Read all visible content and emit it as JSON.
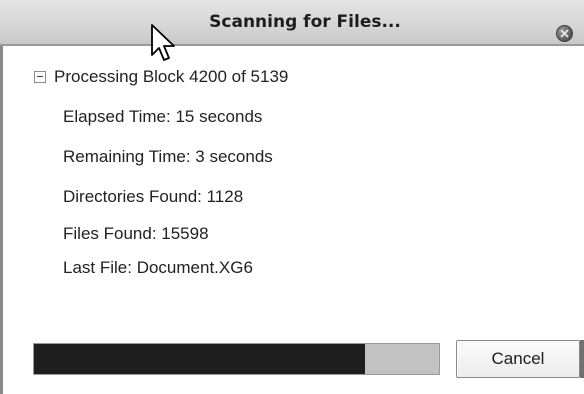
{
  "window": {
    "title": "Scanning for Files..."
  },
  "scan": {
    "heading": "Processing Block 4200 of 5139",
    "details": [
      "Elapsed Time: 15 seconds",
      "Remaining Time: 3 seconds",
      "Directories Found: 1128",
      "Files Found: 15598",
      "Last File: Document.XG6"
    ]
  },
  "progress": {
    "fraction": 0.8173
  },
  "buttons": {
    "cancel_label": "Cancel"
  },
  "icons": {
    "close": "close-icon",
    "tree_toggle": "collapse-icon",
    "cursor": "mouse-pointer-icon"
  }
}
